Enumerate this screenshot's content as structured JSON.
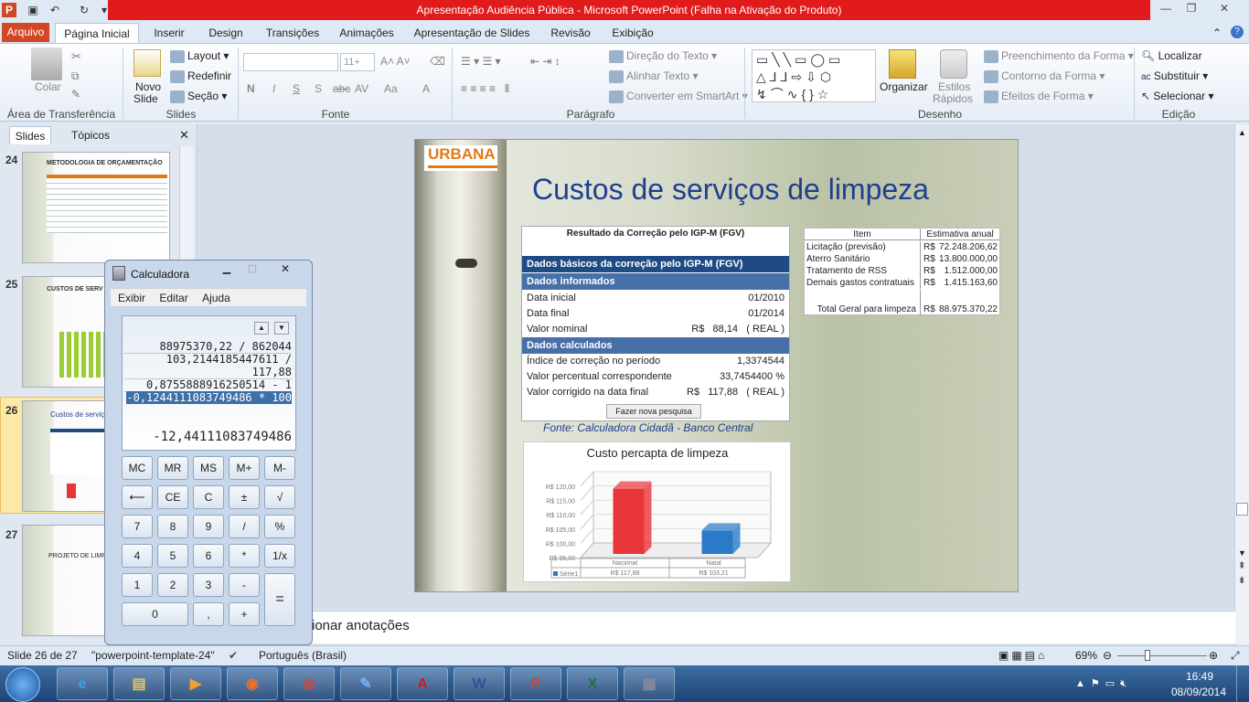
{
  "window": {
    "title": "Apresentação Audiência Pública  -  Microsoft PowerPoint (Falha na Ativação do Produto)",
    "minimize_icon": "minimize-icon",
    "maximize_icon": "maximize-icon",
    "close_icon": "close-icon"
  },
  "ribbon_tabs": {
    "file": "Arquivo",
    "items": [
      "Página Inicial",
      "Inserir",
      "Design",
      "Transições",
      "Animações",
      "Apresentação de Slides",
      "Revisão",
      "Exibição"
    ]
  },
  "ribbon": {
    "clipboard": {
      "paste": "Colar",
      "group": "Área de Transferência"
    },
    "slides": {
      "new_slide": "Novo",
      "new_slide2": "Slide",
      "layout": "Layout",
      "reset": "Redefinir",
      "section": "Seção",
      "group": "Slides"
    },
    "font": {
      "size": "11+",
      "group": "Fonte",
      "bold": "N",
      "italic": "I",
      "underline": "S",
      "shadow": "S",
      "strike": "abc",
      "spacing": "AV",
      "case": "Aa"
    },
    "paragraph": {
      "text_direction": "Direção do Texto",
      "align_text": "Alinhar Texto",
      "smartart": "Converter em SmartArt",
      "group": "Parágrafo"
    },
    "drawing": {
      "arrange": "Organizar",
      "quick_styles": "Estilos",
      "quick_styles2": "Rápidos",
      "fill": "Preenchimento da Forma",
      "outline": "Contorno da Forma",
      "effects": "Efeitos de Forma",
      "group": "Desenho"
    },
    "editing": {
      "find": "Localizar",
      "replace": "Substituir",
      "select": "Selecionar",
      "group": "Edição"
    }
  },
  "left_panel": {
    "tab_slides": "Slides",
    "tab_topics": "Tópicos",
    "thumbs": [
      {
        "num": "24",
        "title": "METODOLOGIA DE ORÇAMENTAÇÃO"
      },
      {
        "num": "25",
        "title": "CUSTOS DE SERV"
      },
      {
        "num": "26",
        "title": "Custos de serviç"
      },
      {
        "num": "27",
        "title": "PROJETO DE LIMP"
      }
    ]
  },
  "slide": {
    "logo": "URBANA",
    "title": "Custos de serviços de limpeza",
    "calc_box": {
      "title": "Resultado da Correção pelo IGP-M (FGV)",
      "header1": "Dados básicos da correção pelo IGP-M (FGV)",
      "header2": "Dados informados",
      "rows1": [
        {
          "label": "Data inicial",
          "value": "01/2010"
        },
        {
          "label": "Data final",
          "value": "01/2014"
        },
        {
          "label": "Valor nominal",
          "value": "R$   88,14   ( REAL )"
        }
      ],
      "header3": "Dados calculados",
      "rows2": [
        {
          "label": "Índice de correção no período",
          "value": "1,3374544"
        },
        {
          "label": "Valor percentual correspondente",
          "value": "33,7454400 %"
        },
        {
          "label": "Valor corrigido na data final",
          "value": "R$   117,88   ( REAL )"
        }
      ],
      "button": "Fazer nova pesquisa"
    },
    "source": "Fonte: Calculadora Cidadã - Banco Central",
    "table": {
      "header_item": "Item",
      "header_value": "Estimativa anual",
      "rows": [
        {
          "item": "Licitação (previsão)",
          "cur": "R$",
          "value": "72.248.206,62"
        },
        {
          "item": "Aterro Sanitário",
          "cur": "R$",
          "value": "13.800.000,00"
        },
        {
          "item": "Tratamento de RSS",
          "cur": "R$",
          "value": "1.512.000,00"
        },
        {
          "item": "Demais gastos contratuais",
          "cur": "R$",
          "value": "1.415.163,60"
        }
      ],
      "total_label": "Total Geral para limpeza",
      "total_cur": "R$",
      "total_value": "88.975.370,22"
    }
  },
  "chart_data": {
    "type": "bar",
    "title": "Custo percapta de limpeza",
    "categories": [
      "Nacional",
      "Natal"
    ],
    "series": [
      {
        "name": "Série1",
        "values": [
          117.88,
          103.21
        ]
      }
    ],
    "data_table": [
      "R$ 117,88",
      "R$ 103,21"
    ],
    "ylim": [
      95,
      120
    ],
    "yticks": [
      "R$ 120,00",
      "R$ 115,00",
      "R$ 110,00",
      "R$ 105,00",
      "R$ 100,00",
      "R$ 95,00"
    ],
    "colors": [
      "#e8353a",
      "#2a7ac8"
    ]
  },
  "notes": "Clique para adicionar anotações",
  "notes_visible": "ionar anotações",
  "status": {
    "slide": "Slide 26 de 27",
    "theme": "\"powerpoint-template-24\"",
    "language": "Português (Brasil)",
    "zoom": "69%"
  },
  "calculator": {
    "title": "Calculadora",
    "menu": [
      "Exibir",
      "Editar",
      "Ajuda"
    ],
    "history": [
      "88975370,22 / 862044",
      "103,2144185447611 /",
      "117,88",
      "0,8755888916250514 - 1"
    ],
    "current_expr": "-0,1244111083749486 * 100",
    "result": "-12,44111083749486",
    "buttons": {
      "mc": "MC",
      "mr": "MR",
      "ms": "MS",
      "mplus": "M+",
      "mminus": "M-",
      "back": "⟵",
      "ce": "CE",
      "c": "C",
      "pm": "±",
      "sqrt": "√",
      "n7": "7",
      "n8": "8",
      "n9": "9",
      "div": "/",
      "pct": "%",
      "n4": "4",
      "n5": "5",
      "n6": "6",
      "mul": "*",
      "inv": "1/x",
      "n1": "1",
      "n2": "2",
      "n3": "3",
      "sub": "-",
      "eq": "=",
      "n0": "0",
      "dot": ",",
      "add": "+"
    }
  },
  "taskbar": {
    "time": "16:49",
    "date": "08/09/2014",
    "apps": [
      "internet-explorer",
      "file-explorer",
      "media-player",
      "firefox",
      "chrome",
      "paint",
      "acrobat",
      "word",
      "powerpoint",
      "excel",
      "calculator"
    ]
  }
}
